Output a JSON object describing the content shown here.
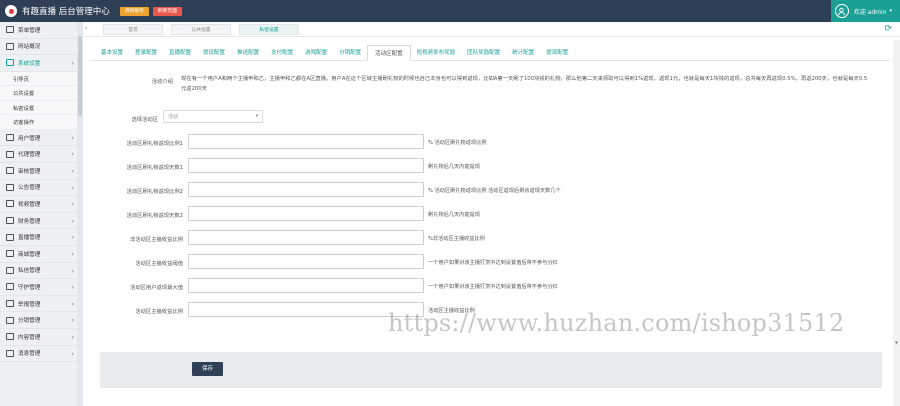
{
  "topbar": {
    "app_title": "有趣直播 后台管理中心",
    "btn_clear_cache": "清除缓存",
    "btn_refresh": "刷新页面",
    "user_label": "欢迎 admin",
    "user_caret": "▾"
  },
  "sidebar": {
    "items": [
      {
        "label": "菜单管理",
        "icon": "monitor-icon"
      },
      {
        "label": "网站概况",
        "icon": "bar-chart-icon"
      },
      {
        "label": "系统设置",
        "icon": "gear-icon",
        "active": true
      },
      {
        "label": "用户管理",
        "icon": "users-icon"
      },
      {
        "label": "代理管理",
        "icon": "desktop-icon"
      },
      {
        "label": "审核管理",
        "icon": "doc-icon"
      },
      {
        "label": "公告管理",
        "icon": "monitor-icon"
      },
      {
        "label": "视频管理",
        "icon": "video-icon"
      },
      {
        "label": "财务管理",
        "icon": "yen-icon"
      },
      {
        "label": "直播管理",
        "icon": "list-icon"
      },
      {
        "label": "商城管理",
        "icon": "cart-icon"
      },
      {
        "label": "私信管理",
        "icon": "mail-icon"
      },
      {
        "label": "守护管理",
        "icon": "shield-icon"
      },
      {
        "label": "举报管理",
        "icon": "flag-icon"
      },
      {
        "label": "分销管理",
        "icon": "share-icon"
      },
      {
        "label": "内容管理",
        "icon": "grid-icon"
      },
      {
        "label": "消息管理",
        "icon": "bell-icon"
      }
    ],
    "sub_items": [
      "引导页",
      "公共设置",
      "私密设置",
      "访客操作"
    ]
  },
  "tabsbar": {
    "tabs": [
      "首页",
      "公共设置",
      "私密设置"
    ],
    "active_index": 2
  },
  "config_tabs": {
    "labels": [
      "基本设置",
      "登录配置",
      "直播配置",
      "提现配置",
      "推送配置",
      "支付配置",
      "游戏配置",
      "分销配置",
      "活动区配置",
      "短视频发布奖励",
      "团队奖励配置",
      "统计配置",
      "提现配置"
    ],
    "active_index": 8
  },
  "form": {
    "intro_label": "活动介绍",
    "intro_text": "现在有一个用户A和两个主播甲和乙，主播甲和乙都在A区直播。用户A在这个区域主播刷礼物的时候也自己本身也可以得到返现，比如A第一天刷了100块钱的礼物，那么他第二天来领取可以得到1%返现，返现1元，也就是每天1块钱的返现，总共每天再返现0.5%，再返200天，也就是每天0.5元返200天",
    "select_label": "选择活动区",
    "select_value": "活动",
    "select_caret": "▾",
    "fields": [
      {
        "label": "活动区刷礼物返现比例1",
        "hint": "% 活动区刷礼物返现比例"
      },
      {
        "label": "活动区刷礼物返现天数1",
        "hint": "刷礼物后几天内能提现"
      },
      {
        "label": "活动区刷礼物返现比例2",
        "hint": "% 活动区刷礼物返现比例 活动区返现后剩余返现天数几个"
      },
      {
        "label": "活动区刷礼物返现天数2",
        "hint": "刷礼物后几天内能提现"
      },
      {
        "label": "非活动区主播收益比例",
        "hint": "%非活动区主播收益比例"
      },
      {
        "label": "活动区主播收益阈值",
        "hint": "一个用户如果对该主播打赏中达到设置值后将不参与分红"
      },
      {
        "label": "活动区用户返现最大值",
        "hint": "一个用户如果对该主播打赏中达到设置值后将不参与分红"
      },
      {
        "label": "活动区主播收益比例",
        "hint": "活动区主播收益比例"
      }
    ],
    "save_label": "保存"
  },
  "watermark": "https://www.huzhan.com/ishop31512"
}
